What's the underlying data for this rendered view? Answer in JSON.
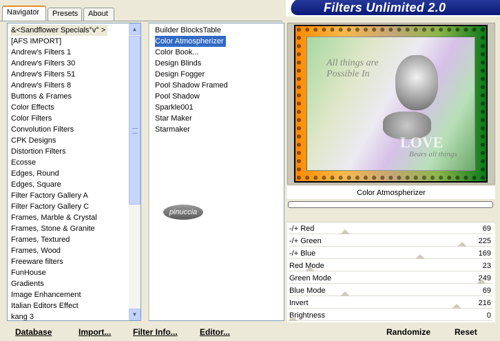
{
  "app": {
    "title": "Filters Unlimited 2.0"
  },
  "tabs": [
    {
      "label": "Navigator"
    },
    {
      "label": "Presets"
    },
    {
      "label": "About"
    }
  ],
  "categories": [
    "&<Sandflower Specials°v° >",
    "[AFS IMPORT]",
    "Andrew's Filters 1",
    "Andrew's Filters 30",
    "Andrew's Filters 51",
    "Andrew's Filters 8",
    "Buttons & Frames",
    "Color Effects",
    "Color Filters",
    "Convolution Filters",
    "CPK Designs",
    "Distortion Filters",
    "Ecosse",
    "Edges, Round",
    "Edges, Square",
    "Filter Factory Gallery A",
    "Filter Factory Gallery C",
    "Frames, Marble & Crystal",
    "Frames, Stone & Granite",
    "Frames, Textured",
    "Frames, Wood",
    "Freeware filters",
    "FunHouse",
    "Gradients",
    "Image Enhancement",
    "Italian Editors Effect",
    "kang 3"
  ],
  "filters": [
    "Builder BlocksTable",
    "Color Atmospherizer",
    "Color Book...",
    "Design Blinds",
    "Design Fogger",
    "Pool Shadow Framed",
    "Pool Shadow",
    "Sparkle001",
    "Star Maker",
    "Starmaker"
  ],
  "selected_filter": "Color Atmospherizer",
  "watermark": "pinuccia",
  "preview": {
    "script1": "All things are Possible In",
    "love": "LOVE",
    "script2": "Bears all things"
  },
  "params": [
    {
      "label": "-/+ Red",
      "value": "69",
      "level": 0.27
    },
    {
      "label": "-/+ Green",
      "value": "225",
      "level": 0.88
    },
    {
      "label": "-/+ Blue",
      "value": "169",
      "level": 0.66
    },
    {
      "label": "Red Mode",
      "value": "23",
      "level": 0.09
    },
    {
      "label": "Green Mode",
      "value": "249",
      "level": 0.98
    },
    {
      "label": "Blue Mode",
      "value": "69",
      "level": 0.27
    },
    {
      "label": "Invert",
      "value": "216",
      "level": 0.85
    },
    {
      "label": "Brightness",
      "value": "0",
      "level": 0
    }
  ],
  "progress": 0,
  "buttons": {
    "database": "Database",
    "import": "Import...",
    "filter_info": "Filter Info...",
    "editor": "Editor...",
    "randomize": "Randomize",
    "reset": "Reset"
  },
  "colors": {
    "selection": "#316ac5",
    "tab_accent": "#e68b2c",
    "banner": "#0a1a78"
  }
}
